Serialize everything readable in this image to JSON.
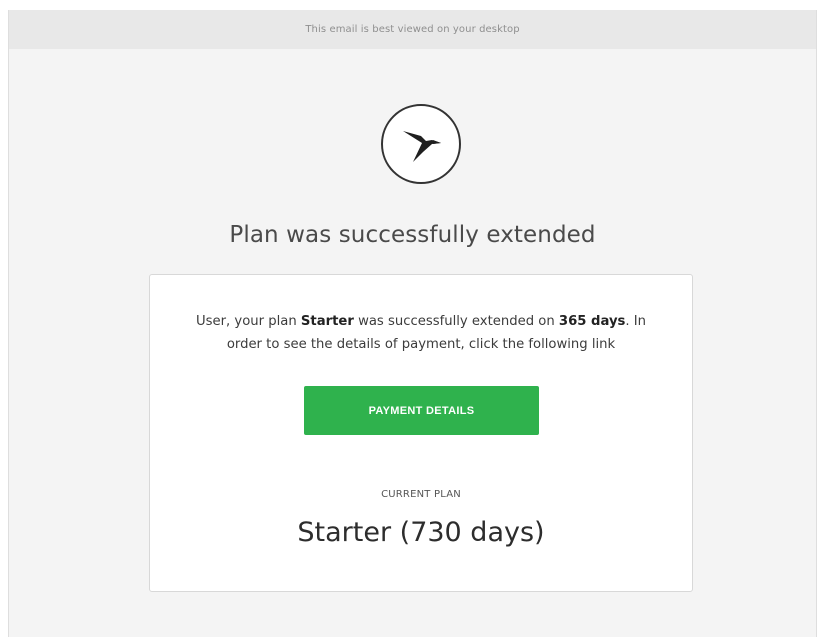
{
  "email": {
    "top_notice": "This email is best viewed on your desktop",
    "logo_icon": "hummingbird-icon",
    "headline": "Plan was successfully extended",
    "message": {
      "prefix": "User, your plan ",
      "plan_bold": "Starter",
      "middle": " was successfully extended on ",
      "days_bold": "365 days",
      "suffix": ". In order to see the details of payment, click the following link"
    },
    "button_label": "PAYMENT DETAILS",
    "current_plan_label": "CURRENT PLAN",
    "current_plan_value": "Starter (730 days)"
  },
  "colors": {
    "accent_green": "#2fb24d",
    "top_bar": "#e8e8e8",
    "background": "#f4f4f4"
  }
}
